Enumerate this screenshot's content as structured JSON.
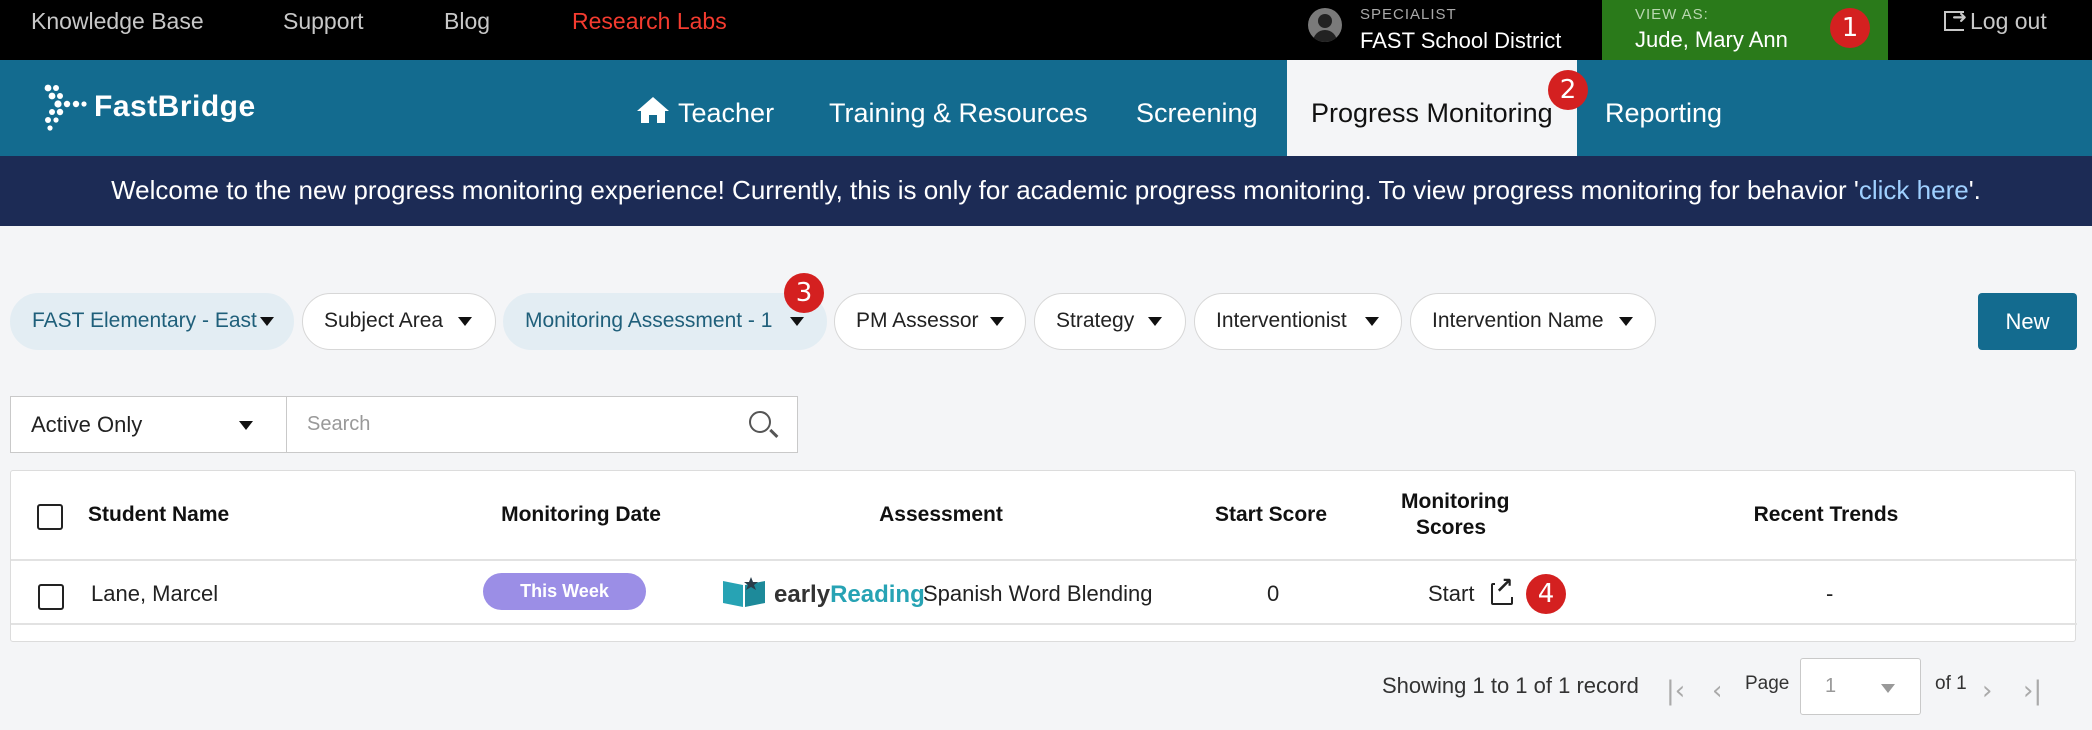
{
  "topbar": {
    "links": [
      "Knowledge Base",
      "Support",
      "Blog",
      "Research Labs"
    ],
    "specialist_label": "SPECIALIST",
    "district": "FAST School District",
    "view_as_label": "VIEW AS:",
    "view_as_user": "Jude, Mary Ann",
    "logout": "Log out"
  },
  "brand": {
    "name": "FastBridge"
  },
  "nav": {
    "items": [
      "Teacher",
      "Training & Resources",
      "Screening",
      "Progress Monitoring",
      "Reporting"
    ],
    "active": "Progress Monitoring"
  },
  "banner": {
    "text": "Welcome to the new progress monitoring experience! Currently, this is only for academic progress monitoring. To view progress monitoring for behavior '",
    "link": "click here",
    "tail": "'."
  },
  "filters": {
    "items": [
      "FAST Elementary - East",
      "Subject Area",
      "Monitoring Assessment - 1",
      "PM Assessor",
      "Strategy",
      "Interventionist",
      "Intervention Name"
    ],
    "new_button": "New"
  },
  "list_controls": {
    "status_select": "Active Only",
    "search_placeholder": "Search"
  },
  "table": {
    "headers": [
      "Student Name",
      "Monitoring Date",
      "Assessment",
      "Start Score",
      "Monitoring Scores",
      "Recent Trends"
    ],
    "rows": [
      {
        "student": "Lane, Marcel",
        "monitoring_date": "This Week",
        "assessment_brand_a": "early",
        "assessment_brand_b": "Reading",
        "assessment": "Spanish Word Blending",
        "start_score": "0",
        "monitoring_scores": "Start",
        "recent_trends": "-"
      }
    ]
  },
  "pagination": {
    "summary": "Showing 1 to 1 of 1 record",
    "page_label": "Page",
    "page_value": "1",
    "of_label": "of 1"
  },
  "callouts": [
    "1",
    "2",
    "3",
    "4"
  ],
  "colors": {
    "topbar": "#000000",
    "nav": "#136b8f",
    "banner": "#1c2b55",
    "view_as": "#2a7a1a",
    "callout": "#d42020",
    "this_week_pill": "#9b8ee6",
    "research_labs": "#f43b2f"
  },
  "icons": [
    "user-icon",
    "logout-icon",
    "home-icon",
    "caret-down-icon",
    "search-icon",
    "external-link-icon",
    "first-page-icon",
    "prev-page-icon",
    "next-page-icon",
    "last-page-icon"
  ]
}
